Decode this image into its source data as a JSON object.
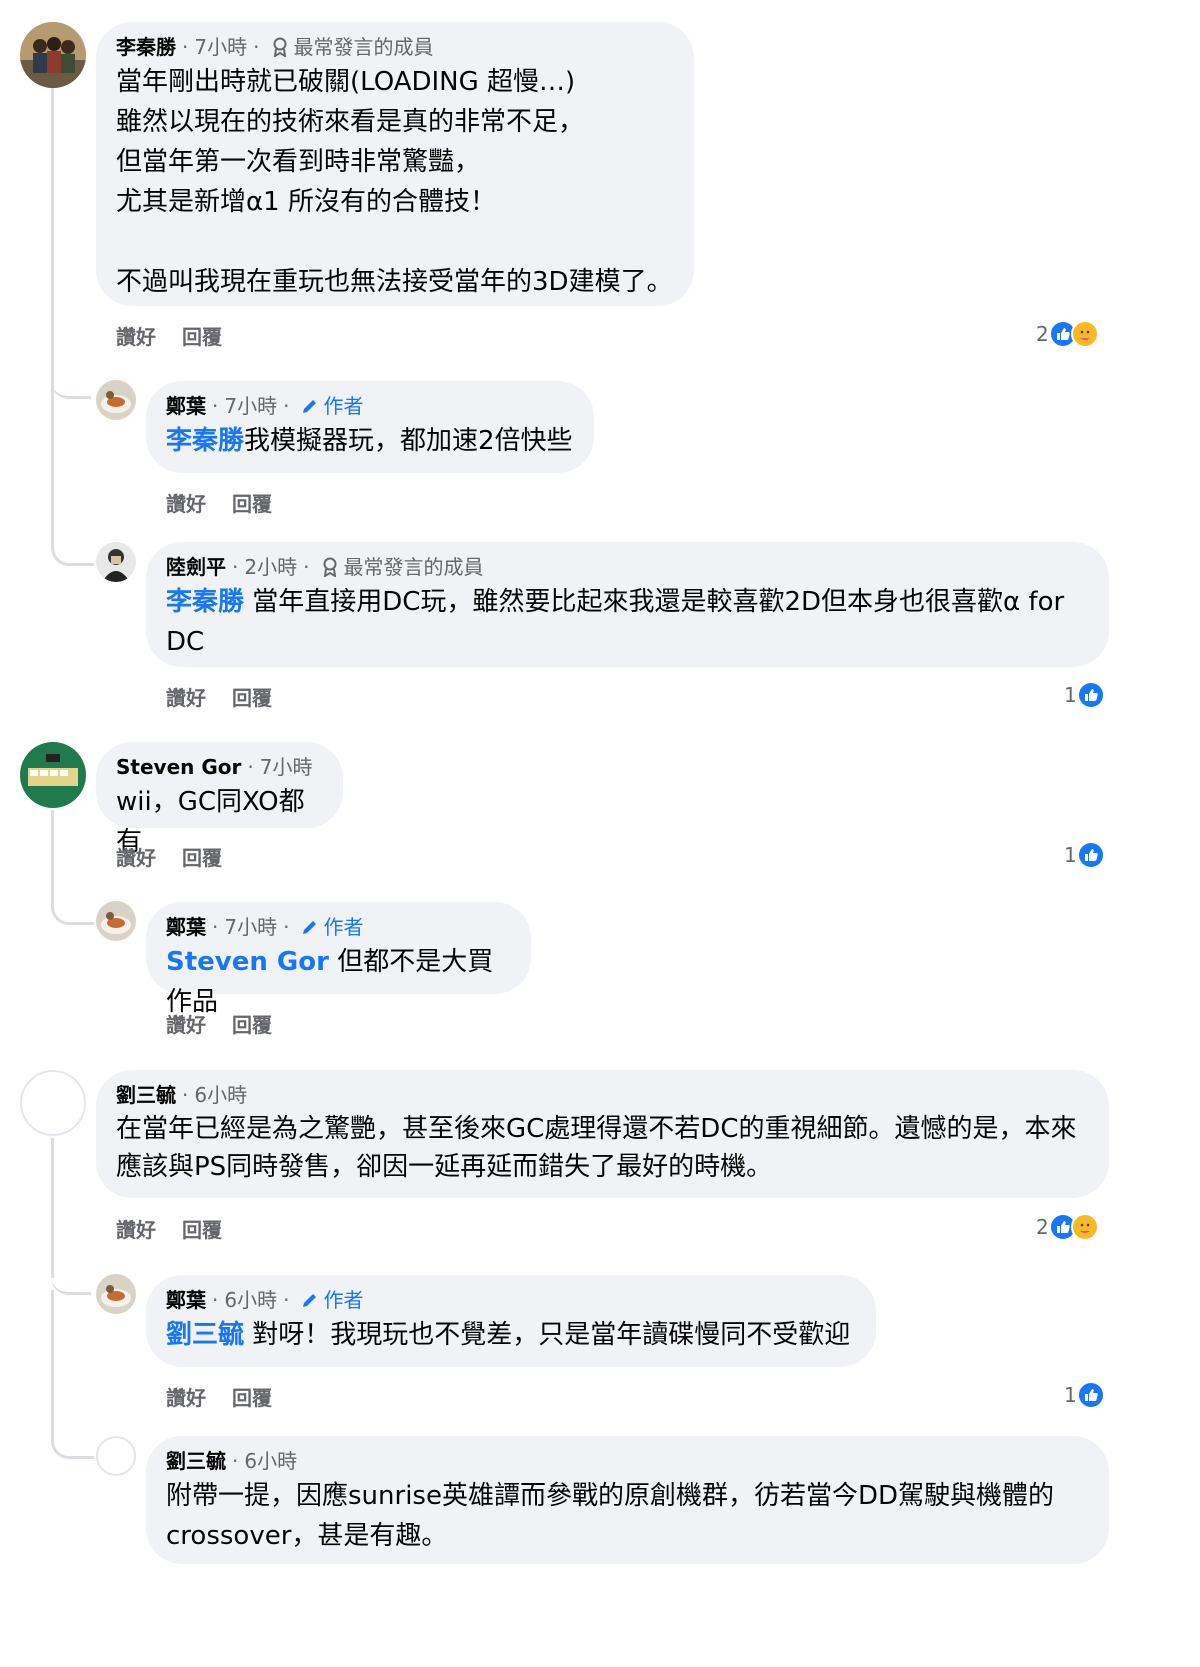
{
  "labels": {
    "like": "讚好",
    "reply": "回覆"
  },
  "c1": {
    "name": "李秦勝",
    "time": "7小時",
    "badge": "最常發言的成員",
    "text": "當年剛出時就已破關(LOADING 超慢…)\n雖然以現在的技術來看是真的非常不足，\n但當年第一次看到時非常驚豔，\n尤其是新增α1 所沒有的合體技！\n\n不過叫我現在重玩也無法接受當年的3D建模了。",
    "reactions": "2"
  },
  "r1": {
    "name": "鄭葉",
    "time": "7小時",
    "badge": "作者",
    "mention": "李秦勝",
    "text": "我模擬器玩，都加速2倍快些"
  },
  "r2": {
    "name": "陸劍平",
    "time": "2小時",
    "badge": "最常發言的成員",
    "mention": "李秦勝",
    "text": " 當年直接用DC玩，雖然要比起來我還是較喜歡2D但本身也很喜歡α for DC",
    "reactions": "1"
  },
  "c2": {
    "name": "Steven Gor",
    "time": "7小時",
    "text": "wii，GC同XO都有",
    "reactions": "1"
  },
  "r3": {
    "name": "鄭葉",
    "time": "7小時",
    "badge": "作者",
    "mention": "Steven Gor",
    "text": " 但都不是大買作品"
  },
  "c3": {
    "name": "劉三毓",
    "time": "6小時",
    "text": "在當年已經是為之驚艷，甚至後來GC處理得還不若DC的重視細節。遺憾的是，本來應該與PS同時發售，卻因一延再延而錯失了最好的時機。",
    "reactions": "2"
  },
  "r4": {
    "name": "鄭葉",
    "time": "6小時",
    "badge": "作者",
    "mention": "劉三毓",
    "text": " 對呀！我現玩也不覺差，只是當年讀碟慢同不受歡迎",
    "reactions": "1"
  },
  "r5": {
    "name": "劉三毓",
    "time": "6小時",
    "text": "附帶一提，因應sunrise英雄譚而參戰的原創機群，彷若當今DD駕駛與機體的crossover，甚是有趣。"
  },
  "colors": {
    "like_blue": "#1877f2",
    "bubble_bg": "#f0f2f5",
    "meta_gray": "#65676b"
  }
}
